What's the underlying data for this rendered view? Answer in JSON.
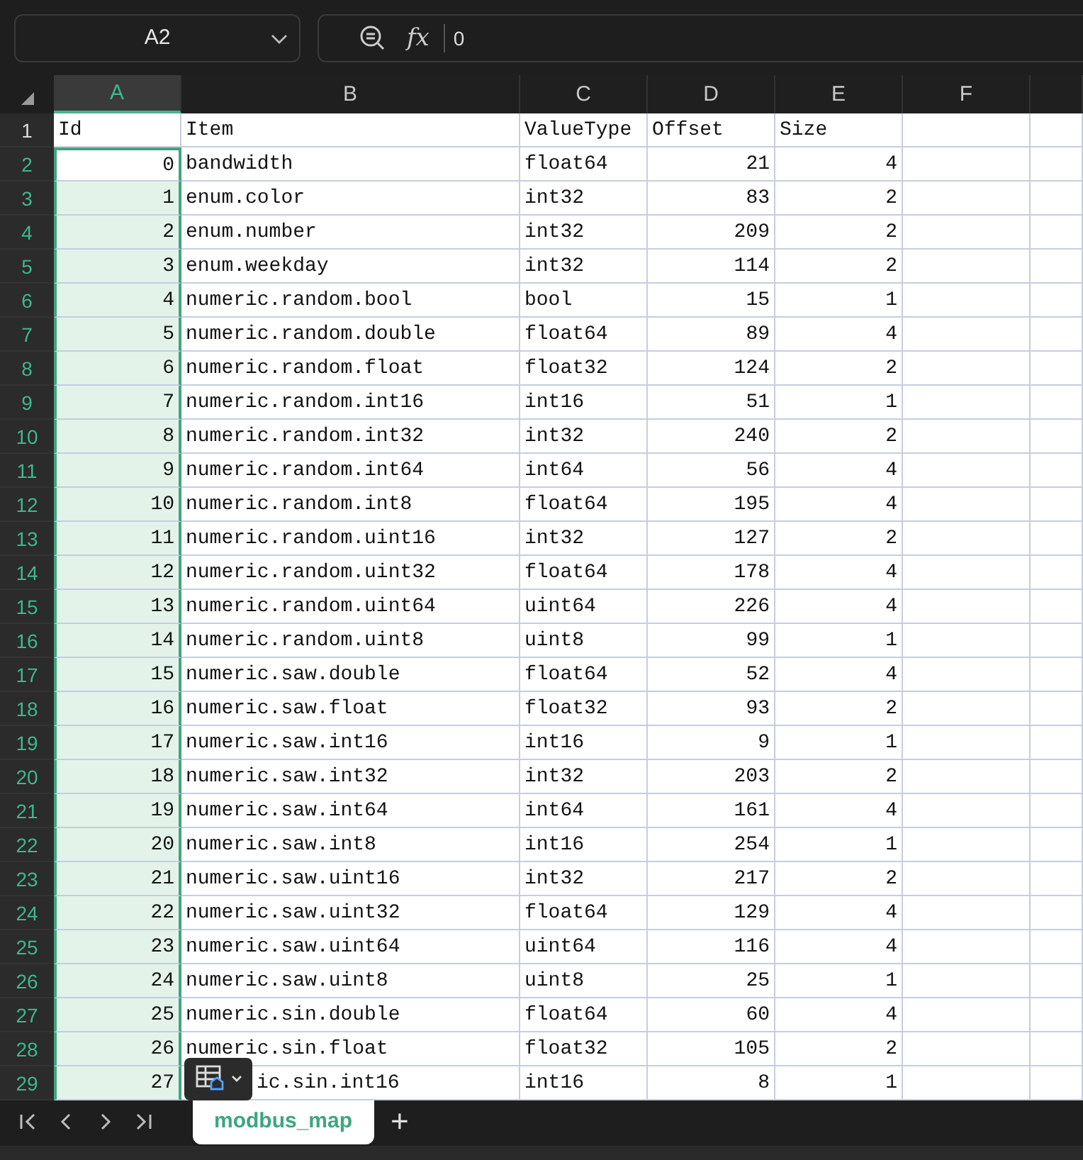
{
  "formula_bar": {
    "cell_name": "A2",
    "function_label": "fx",
    "value": "0"
  },
  "columns": [
    {
      "label": "A",
      "selected": true
    },
    {
      "label": "B",
      "selected": false
    },
    {
      "label": "C",
      "selected": false
    },
    {
      "label": "D",
      "selected": false
    },
    {
      "label": "E",
      "selected": false
    },
    {
      "label": "F",
      "selected": false
    }
  ],
  "rows": [
    {
      "number": "1",
      "kind": "header",
      "selected": false,
      "active": false,
      "cells": [
        "Id",
        "Item",
        "ValueType",
        "Offset",
        "Size"
      ]
    },
    {
      "number": "2",
      "kind": "data",
      "selected": true,
      "active": true,
      "cells": [
        "0",
        "bandwidth",
        "float64",
        "21",
        "4"
      ]
    },
    {
      "number": "3",
      "kind": "data",
      "selected": true,
      "active": false,
      "cells": [
        "1",
        "enum.color",
        "int32",
        "83",
        "2"
      ]
    },
    {
      "number": "4",
      "kind": "data",
      "selected": true,
      "active": false,
      "cells": [
        "2",
        "enum.number",
        "int32",
        "209",
        "2"
      ]
    },
    {
      "number": "5",
      "kind": "data",
      "selected": true,
      "active": false,
      "cells": [
        "3",
        "enum.weekday",
        "int32",
        "114",
        "2"
      ]
    },
    {
      "number": "6",
      "kind": "data",
      "selected": true,
      "active": false,
      "cells": [
        "4",
        "numeric.random.bool",
        "bool",
        "15",
        "1"
      ]
    },
    {
      "number": "7",
      "kind": "data",
      "selected": true,
      "active": false,
      "cells": [
        "5",
        "numeric.random.double",
        "float64",
        "89",
        "4"
      ]
    },
    {
      "number": "8",
      "kind": "data",
      "selected": true,
      "active": false,
      "cells": [
        "6",
        "numeric.random.float",
        "float32",
        "124",
        "2"
      ]
    },
    {
      "number": "9",
      "kind": "data",
      "selected": true,
      "active": false,
      "cells": [
        "7",
        "numeric.random.int16",
        "int16",
        "51",
        "1"
      ]
    },
    {
      "number": "10",
      "kind": "data",
      "selected": true,
      "active": false,
      "cells": [
        "8",
        "numeric.random.int32",
        "int32",
        "240",
        "2"
      ]
    },
    {
      "number": "11",
      "kind": "data",
      "selected": true,
      "active": false,
      "cells": [
        "9",
        "numeric.random.int64",
        "int64",
        "56",
        "4"
      ]
    },
    {
      "number": "12",
      "kind": "data",
      "selected": true,
      "active": false,
      "cells": [
        "10",
        "numeric.random.int8",
        "float64",
        "195",
        "4"
      ]
    },
    {
      "number": "13",
      "kind": "data",
      "selected": true,
      "active": false,
      "cells": [
        "11",
        "numeric.random.uint16",
        "int32",
        "127",
        "2"
      ]
    },
    {
      "number": "14",
      "kind": "data",
      "selected": true,
      "active": false,
      "cells": [
        "12",
        "numeric.random.uint32",
        "float64",
        "178",
        "4"
      ]
    },
    {
      "number": "15",
      "kind": "data",
      "selected": true,
      "active": false,
      "cells": [
        "13",
        "numeric.random.uint64",
        "uint64",
        "226",
        "4"
      ]
    },
    {
      "number": "16",
      "kind": "data",
      "selected": true,
      "active": false,
      "cells": [
        "14",
        "numeric.random.uint8",
        "uint8",
        "99",
        "1"
      ]
    },
    {
      "number": "17",
      "kind": "data",
      "selected": true,
      "active": false,
      "cells": [
        "15",
        "numeric.saw.double",
        "float64",
        "52",
        "4"
      ]
    },
    {
      "number": "18",
      "kind": "data",
      "selected": true,
      "active": false,
      "cells": [
        "16",
        "numeric.saw.float",
        "float32",
        "93",
        "2"
      ]
    },
    {
      "number": "19",
      "kind": "data",
      "selected": true,
      "active": false,
      "cells": [
        "17",
        "numeric.saw.int16",
        "int16",
        "9",
        "1"
      ]
    },
    {
      "number": "20",
      "kind": "data",
      "selected": true,
      "active": false,
      "cells": [
        "18",
        "numeric.saw.int32",
        "int32",
        "203",
        "2"
      ]
    },
    {
      "number": "21",
      "kind": "data",
      "selected": true,
      "active": false,
      "cells": [
        "19",
        "numeric.saw.int64",
        "int64",
        "161",
        "4"
      ]
    },
    {
      "number": "22",
      "kind": "data",
      "selected": true,
      "active": false,
      "cells": [
        "20",
        "numeric.saw.int8",
        "int16",
        "254",
        "1"
      ]
    },
    {
      "number": "23",
      "kind": "data",
      "selected": true,
      "active": false,
      "cells": [
        "21",
        "numeric.saw.uint16",
        "int32",
        "217",
        "2"
      ]
    },
    {
      "number": "24",
      "kind": "data",
      "selected": true,
      "active": false,
      "cells": [
        "22",
        "numeric.saw.uint32",
        "float64",
        "129",
        "4"
      ]
    },
    {
      "number": "25",
      "kind": "data",
      "selected": true,
      "active": false,
      "cells": [
        "23",
        "numeric.saw.uint64",
        "uint64",
        "116",
        "4"
      ]
    },
    {
      "number": "26",
      "kind": "data",
      "selected": true,
      "active": false,
      "cells": [
        "24",
        "numeric.saw.uint8",
        "uint8",
        "25",
        "1"
      ]
    },
    {
      "number": "27",
      "kind": "data",
      "selected": true,
      "active": false,
      "cells": [
        "25",
        "numeric.sin.double",
        "float64",
        "60",
        "4"
      ]
    },
    {
      "number": "28",
      "kind": "data",
      "selected": true,
      "active": false,
      "cells": [
        "26",
        "numeric.sin.float",
        "float32",
        "105",
        "2"
      ]
    },
    {
      "number": "29",
      "kind": "data",
      "selected": true,
      "active": false,
      "covered": true,
      "cells": [
        "27",
        "ic.sin.int16",
        "int16",
        "8",
        "1"
      ]
    }
  ],
  "sheet_tabs": [
    {
      "label": "modbus_map",
      "selected": true
    }
  ],
  "add_sheet_label": "+"
}
